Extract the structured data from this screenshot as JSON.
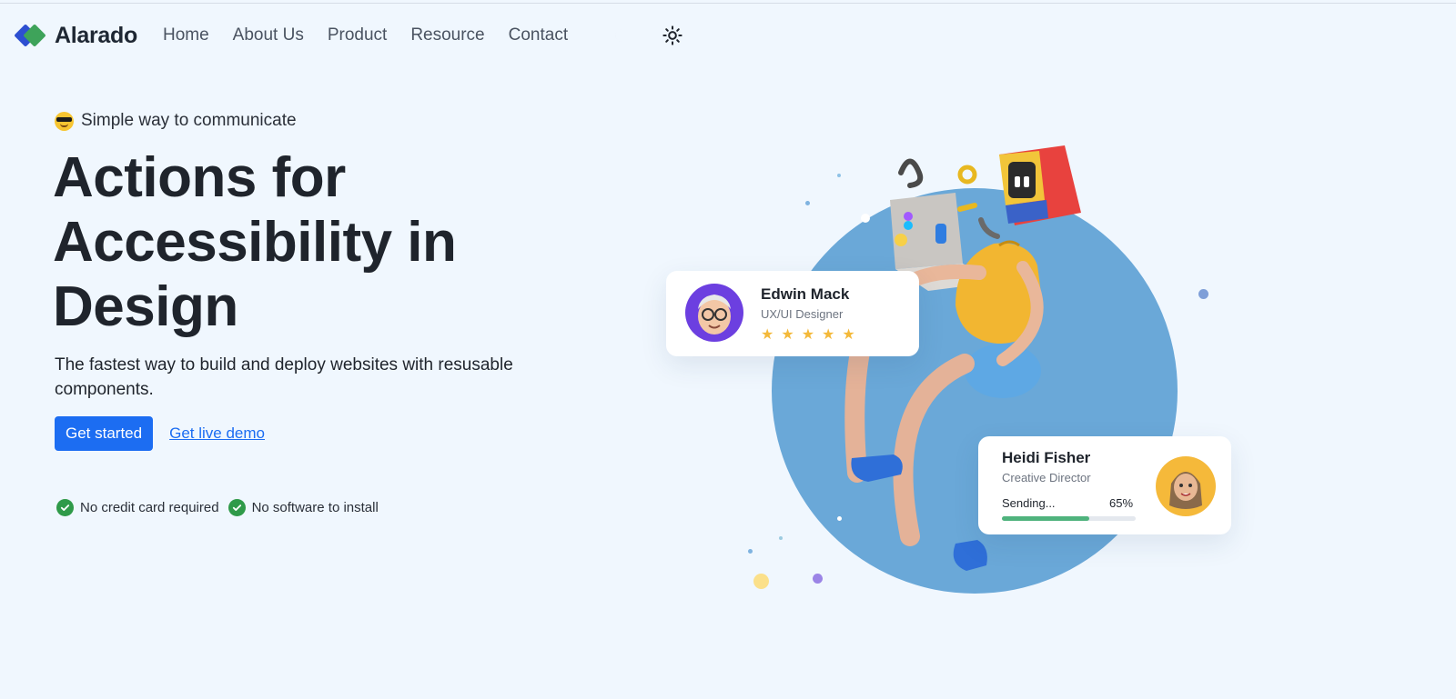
{
  "brand": {
    "name": "Alarado"
  },
  "nav": {
    "links": [
      "Home",
      "About Us",
      "Product",
      "Resource",
      "Contact"
    ]
  },
  "hero": {
    "eyebrow": "Simple way to communicate",
    "headline": "Actions for Accessibility in Design",
    "subtext": "The fastest way to build and deploy websites with resusable components.",
    "primary_cta": "Get started",
    "secondary_cta": "Get live demo",
    "checks": [
      "No credit card required",
      "No software to install"
    ]
  },
  "cards": {
    "edwin": {
      "name": "Edwin Mack",
      "role": "UX/UI Designer",
      "rating": 5
    },
    "heidi": {
      "name": "Heidi Fisher",
      "role": "Creative Director",
      "status": "Sending...",
      "percent_label": "65%",
      "progress": 0.65
    }
  },
  "icons": {
    "theme_dark": "moon-icon",
    "theme_light": "sun-icon",
    "check": "check-circle-icon",
    "emoji": "sunglasses-emoji-icon"
  },
  "colors": {
    "background": "#f0f7fe",
    "primary": "#1c6df2",
    "accent_green": "#2f9a49",
    "circle": "#6aa8d8",
    "star": "#f4b93a"
  }
}
